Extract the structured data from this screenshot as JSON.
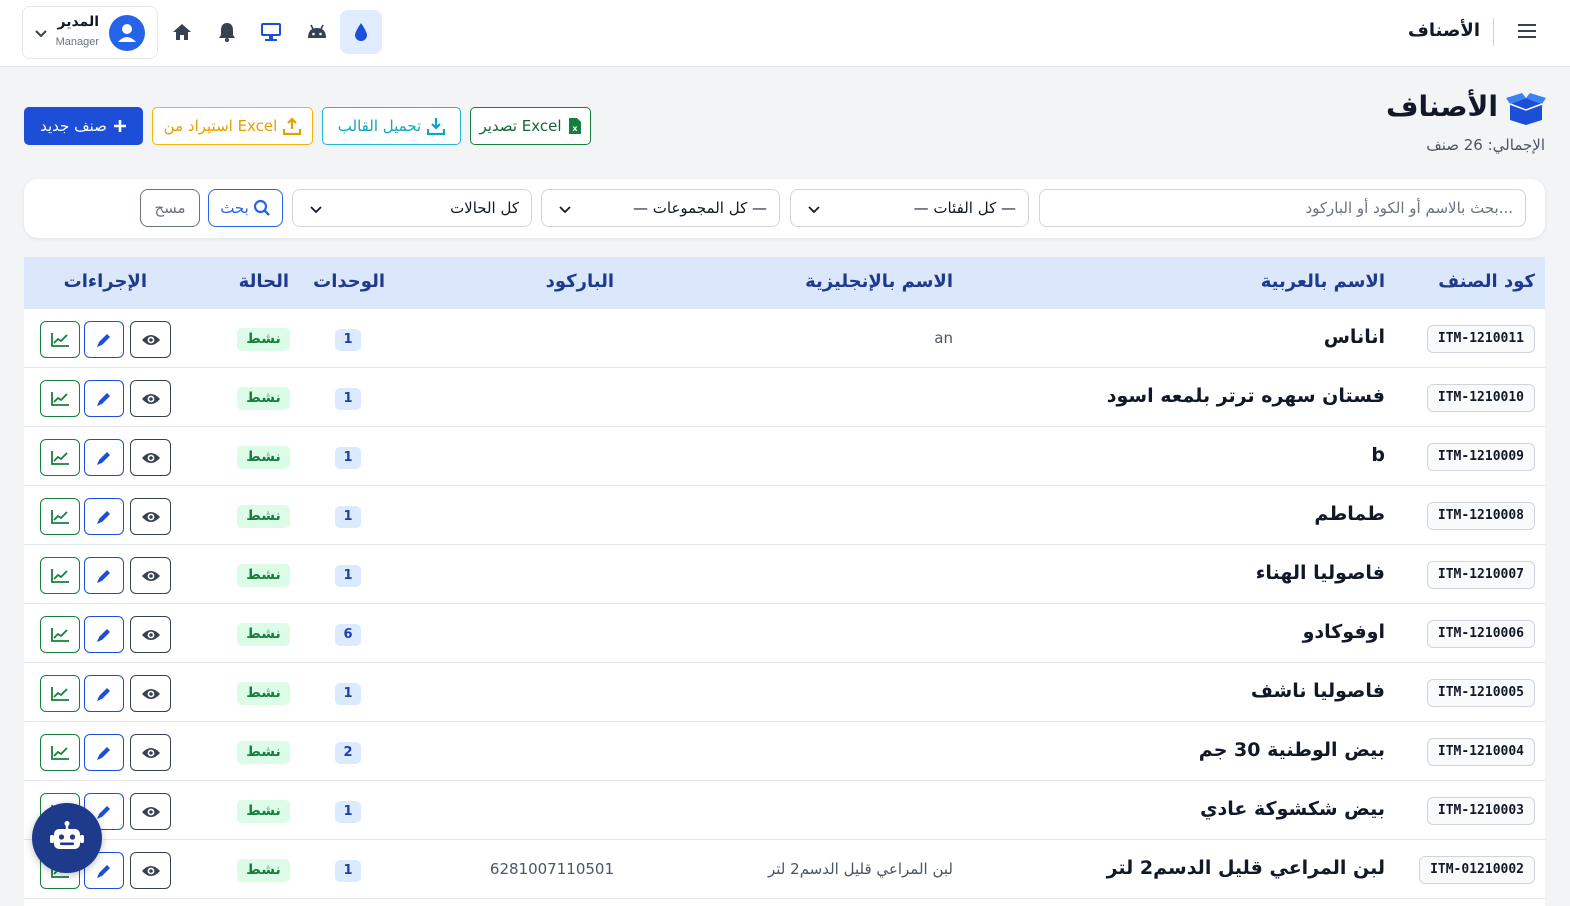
{
  "topbar": {
    "title": "الأصناف",
    "user": {
      "name": "المدير",
      "role": "Manager"
    },
    "icons": [
      "home-icon",
      "bell-icon",
      "monitor-icon",
      "android-icon",
      "drop-icon"
    ]
  },
  "header": {
    "title": "الأصناف",
    "total": "الإجمالي: 26 صنف",
    "buttons": {
      "export": "تصدير Excel",
      "template": "تحميل القالب",
      "import": "استيراد من Excel",
      "new": "صنف جديد"
    }
  },
  "filters": {
    "search_placeholder": "بحث بالاسم أو الكود أو الباركود...",
    "category": "— كل الفئات —",
    "group": "— كل المجموعات —",
    "status": "كل الحالات",
    "search_btn": "بحث",
    "clear_btn": "مسح"
  },
  "table": {
    "headers": {
      "code": "كود الصنف",
      "name_ar": "الاسم بالعربية",
      "name_en": "الاسم بالإنجليزية",
      "barcode": "الباركود",
      "units": "الوحدات",
      "status": "الحالة",
      "actions": "الإجراءات"
    },
    "rows": [
      {
        "code": "ITM-1210011",
        "name_ar": "اناناس",
        "name_en": "an",
        "barcode": "",
        "units": "1",
        "status": "نشط"
      },
      {
        "code": "ITM-1210010",
        "name_ar": "فستان سهره ترتر بلمعه اسود",
        "name_en": "",
        "barcode": "",
        "units": "1",
        "status": "نشط"
      },
      {
        "code": "ITM-1210009",
        "name_ar": "b",
        "name_en": "",
        "barcode": "",
        "units": "1",
        "status": "نشط"
      },
      {
        "code": "ITM-1210008",
        "name_ar": "طماطم",
        "name_en": "",
        "barcode": "",
        "units": "1",
        "status": "نشط"
      },
      {
        "code": "ITM-1210007",
        "name_ar": "فاصوليا الهناء",
        "name_en": "",
        "barcode": "",
        "units": "1",
        "status": "نشط"
      },
      {
        "code": "ITM-1210006",
        "name_ar": "اوفوكادو",
        "name_en": "",
        "barcode": "",
        "units": "6",
        "status": "نشط"
      },
      {
        "code": "ITM-1210005",
        "name_ar": "فاصوليا ناشف",
        "name_en": "",
        "barcode": "",
        "units": "1",
        "status": "نشط"
      },
      {
        "code": "ITM-1210004",
        "name_ar": "بيض الوطنية 30 جم",
        "name_en": "",
        "barcode": "",
        "units": "2",
        "status": "نشط"
      },
      {
        "code": "ITM-1210003",
        "name_ar": "بيض شكشوكة عادي",
        "name_en": "",
        "barcode": "",
        "units": "1",
        "status": "نشط"
      },
      {
        "code": "ITM-01210002",
        "name_ar": "لبن المراعي قليل الدسم2 لتر",
        "name_en": "لبن المراعي قليل الدسم2 لتر",
        "barcode": "6281007110501",
        "units": "1",
        "status": "نشط"
      }
    ]
  },
  "colors": {
    "primary": "#1d4ed8",
    "header_bg": "#dbe8fc",
    "active_badge": "#dcfce7",
    "export": "#15803d",
    "template": "#22b8cf",
    "import": "#f4b400"
  }
}
